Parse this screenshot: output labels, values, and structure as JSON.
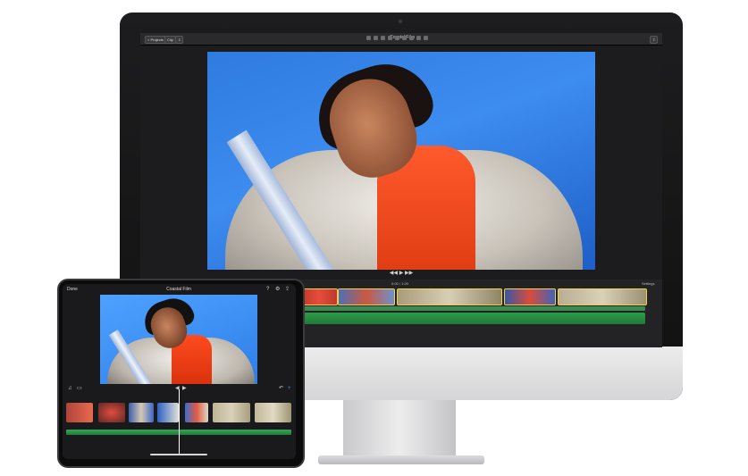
{
  "mac": {
    "window_title": "Coastal Film",
    "toolbar_buttons": [
      "< Projects",
      "Clip",
      "⇩"
    ],
    "share_label": "⇪",
    "settings_label": "Settings",
    "timecode": "0:00 / 1:20"
  },
  "ipad": {
    "done_label": "Done",
    "project_title": "Coastal Film"
  },
  "colors": {
    "sky": "#3d8cf0",
    "hoodie": "#ff5a2c",
    "audio_track": "#2e9b4a",
    "clip_border": "#f2d04a"
  },
  "icons": {
    "apple": "",
    "play": "▶",
    "back": "◀◀",
    "forward": "▶▶"
  }
}
